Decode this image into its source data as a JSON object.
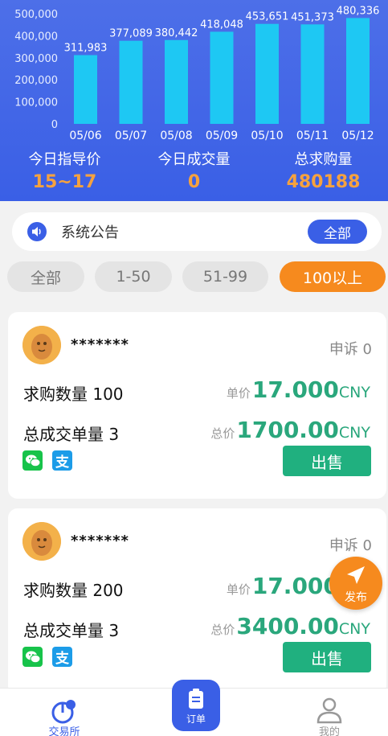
{
  "chart_data": {
    "type": "bar",
    "categories": [
      "05/06",
      "05/07",
      "05/08",
      "05/09",
      "05/10",
      "05/11",
      "05/12"
    ],
    "values": [
      311983,
      377089,
      380442,
      418048,
      453651,
      451373,
      480336
    ],
    "value_labels": [
      "311,983",
      "377,089",
      "380,442",
      "418,048",
      "453,651",
      "451,373",
      "480,336"
    ],
    "yticks": [
      "500,000",
      "400,000",
      "300,000",
      "200,000",
      "100,000",
      "0"
    ],
    "ylim": [
      0,
      500000
    ],
    "bar_color": "#1ec8f3",
    "grid": false
  },
  "stats": {
    "guide_price": {
      "label": "今日指导价",
      "value": "15~17"
    },
    "today_volume": {
      "label": "今日成交量",
      "value": "0"
    },
    "total_demand": {
      "label": "总求购量",
      "value": "480188"
    }
  },
  "notice": {
    "text": "系统公告",
    "button": "全部",
    "icon": "speaker-icon"
  },
  "filters": [
    {
      "label": "全部",
      "active": false
    },
    {
      "label": "1-50",
      "active": false
    },
    {
      "label": "51-99",
      "active": false
    },
    {
      "label": "100以上",
      "active": true
    }
  ],
  "orders": [
    {
      "username": "*******",
      "appeal": "申诉 0",
      "quantity": "求购数量 100",
      "deals": "总成交单量 3",
      "unit_caption": "单价",
      "unit_price": "17.000",
      "total_caption": "总价",
      "total_price": "1700.00",
      "currency": "CNY",
      "sell": "出售"
    },
    {
      "username": "*******",
      "appeal": "申诉 0",
      "quantity": "求购数量 200",
      "deals": "总成交单量 3",
      "unit_caption": "单价",
      "unit_price": "17.000",
      "total_caption": "总价",
      "total_price": "3400.00",
      "currency": "CNY",
      "sell": "出售"
    }
  ],
  "payment_icons": {
    "wechat": "wechat-pay-icon",
    "alipay": "alipay-icon",
    "alipay_glyph": "支"
  },
  "publish": {
    "label": "发布"
  },
  "nav": {
    "market": "交易所",
    "orders": "订单",
    "mine": "我的"
  },
  "colors": {
    "primary": "#3a5fe6",
    "accent": "#f68a1e",
    "green": "#20b07f",
    "price": "#2aa77c"
  }
}
